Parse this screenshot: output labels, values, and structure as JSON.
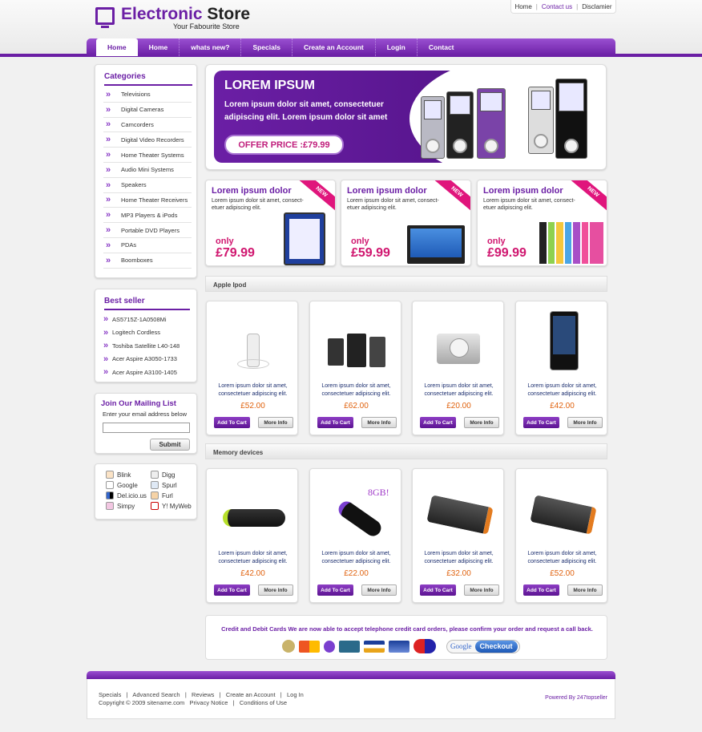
{
  "header": {
    "logo_accent": "Electronic",
    "logo_rest": "Store",
    "tagline": "Your Fabourite Store",
    "top_links": [
      "Home",
      "Contact us",
      "Disclamier"
    ]
  },
  "nav": [
    "Home",
    "Home",
    "whats new?",
    "Specials",
    "Create an Account",
    "Login",
    "Contact"
  ],
  "categories": {
    "title": "Categories",
    "items": [
      "Televisions",
      "Digital Cameras",
      "Camcorders",
      "Digital Video Recorders",
      "Home Theater Systems",
      "Audio Mini Systems",
      "Speakers",
      "Home Theater Receivers",
      "MP3 Players & iPods",
      "Portable DVD Players",
      "PDAs",
      "Boomboxes"
    ]
  },
  "bestseller": {
    "title": "Best seller",
    "items": [
      "AS5715Z-1A0508Mi",
      "Logitech Cordless",
      "Toshiba Satellite L40-148",
      "Acer Aspire A3050-1733",
      "Acer Aspire A3100-1405"
    ]
  },
  "mailing": {
    "title": "Join Our Mailing List",
    "subtitle": "Enter your email address below",
    "button": "Submit"
  },
  "social": [
    "Blink",
    "Digg",
    "Google",
    "Spurl",
    "Del.icio.us",
    "Furl",
    "Simpy",
    "Y! MyWeb"
  ],
  "banner": {
    "title": "LOREM IPSUM",
    "text": "Lorem ipsum dolor sit amet, consectetuer adipiscing elit. Lorem ipsum dolor sit amet",
    "offer": "OFFER PRICE :£79.99"
  },
  "promos": [
    {
      "title": "Lorem ipsum dolor",
      "desc": "Lorem ipsum dolor sit amet, consect-etuer adipiscing elit.",
      "only": "only",
      "price": "£79.99",
      "badge": "NEW"
    },
    {
      "title": "Lorem ipsum dolor",
      "desc": "Lorem ipsum dolor sit amet, consect-etuer adipiscing elit.",
      "only": "only",
      "price": "£59.99",
      "badge": "NEW"
    },
    {
      "title": "Lorem ipsum dolor",
      "desc": "Lorem ipsum dolor sit amet, consect-etuer adipiscing elit.",
      "only": "only",
      "price": "£99.99",
      "badge": "NEW"
    }
  ],
  "sections": [
    "Apple Ipod",
    "Memory devices"
  ],
  "products": {
    "desc": "Lorem ipsum dolor sit amet, consectetuer adipiscing elit.",
    "add": "Add To Cart",
    "more": "More Info",
    "ipod_prices": [
      "£52.00",
      "£62.00",
      "£20.00",
      "£42.00"
    ],
    "memory_prices": [
      "£42.00",
      "£22.00",
      "£32.00",
      "£52.00"
    ],
    "usb_label": "8GB!"
  },
  "payment": {
    "message": "Credit and Debit Cards We are now able to accept telephone credit card orders, please confirm your order and request a call back.",
    "google": "Google",
    "checkout": "Checkout"
  },
  "footer": {
    "links": "Specials   |   Advanced Search   |   Reviews   |   Create an Account   |   Log In",
    "copyright": "Copyright © 2009 sitename.com   Privacy Notice   |   Conditions of Use",
    "powered": "Powered By 247topseller"
  },
  "colors": {
    "accent": "#6b1fa5",
    "price": "#e0620e",
    "promo_price": "#d0166f"
  }
}
